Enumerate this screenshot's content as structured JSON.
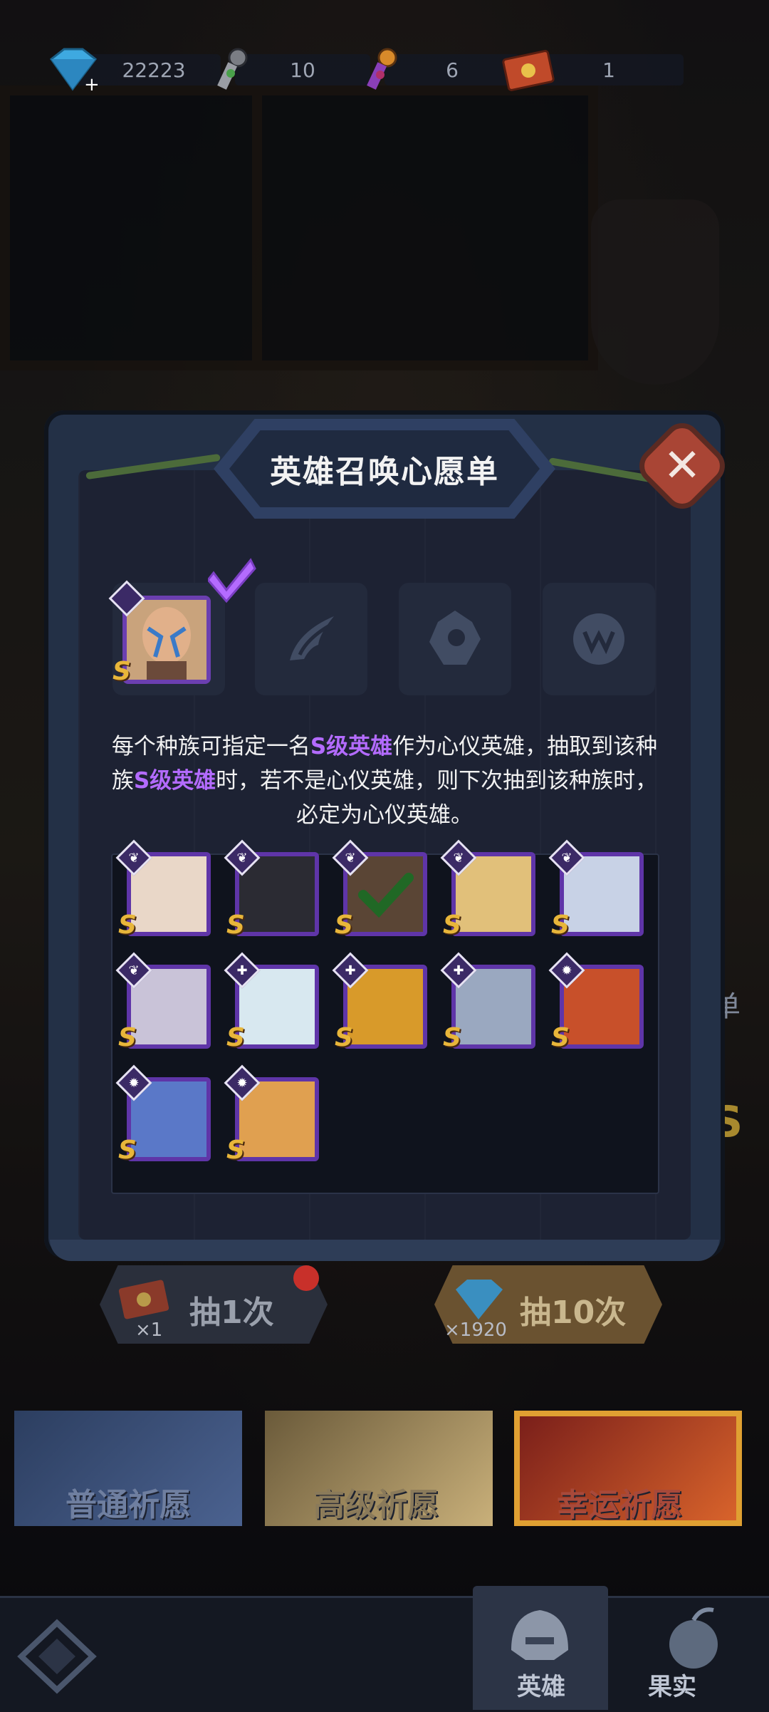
{
  "resources": [
    {
      "name": "diamond-icon",
      "value": "22223"
    },
    {
      "name": "scroll-key-icon",
      "value": "10"
    },
    {
      "name": "purple-key-icon",
      "value": "6"
    },
    {
      "name": "summon-ticket-icon",
      "value": "1"
    }
  ],
  "dialog": {
    "title": "英雄召唤心愿单",
    "close_icon": "close-icon",
    "description_parts": [
      "每个种族可指定一名",
      "S级英雄",
      "作为心仪英雄，抽取到该种族",
      "S级英雄",
      "时，若不是心仪英雄，则下次抽到该种族时，必定为心仪英雄。"
    ],
    "race_slots": [
      {
        "icon": "selected-hero-portrait",
        "state": "selected"
      },
      {
        "icon": "wing-emblem-icon",
        "state": "empty"
      },
      {
        "icon": "mech-emblem-icon",
        "state": "empty"
      },
      {
        "icon": "beast-emblem-icon",
        "state": "empty"
      }
    ],
    "rank_label": "S",
    "heroes": [
      {
        "portrait": "white-crowned-queen",
        "race": "angel",
        "selected": false
      },
      {
        "portrait": "masked-ninja",
        "race": "angel",
        "selected": false
      },
      {
        "portrait": "bald-warrior",
        "race": "angel",
        "selected": true
      },
      {
        "portrait": "golden-paladin",
        "race": "angel",
        "selected": false
      },
      {
        "portrait": "armored-knight",
        "race": "angel",
        "selected": false
      },
      {
        "portrait": "silver-maiden",
        "race": "angel",
        "selected": false
      },
      {
        "portrait": "white-robot",
        "race": "mech",
        "selected": false
      },
      {
        "portrait": "gold-tank-robot",
        "race": "mech",
        "selected": false
      },
      {
        "portrait": "blue-mech-suit",
        "race": "mech",
        "selected": false
      },
      {
        "portrait": "red-lion",
        "race": "beast",
        "selected": false
      },
      {
        "portrait": "blue-ogre",
        "race": "beast",
        "selected": false
      },
      {
        "portrait": "leopard-warrior",
        "race": "beast",
        "selected": false
      }
    ]
  },
  "draw_buttons": [
    {
      "label": "抽1次",
      "cost": "×1",
      "icon": "summon-ticket-icon"
    },
    {
      "label": "抽10次",
      "cost": "×1920",
      "icon": "diamond-icon"
    }
  ],
  "wish_tabs": [
    {
      "label": "普通祈愿"
    },
    {
      "label": "高级祈愿"
    },
    {
      "label": "幸运祈愿",
      "active": true
    }
  ],
  "bottom_nav": [
    {
      "label": "英雄"
    },
    {
      "label": "果实"
    }
  ],
  "side_labels": {
    "list": "单",
    "rank": "S"
  }
}
